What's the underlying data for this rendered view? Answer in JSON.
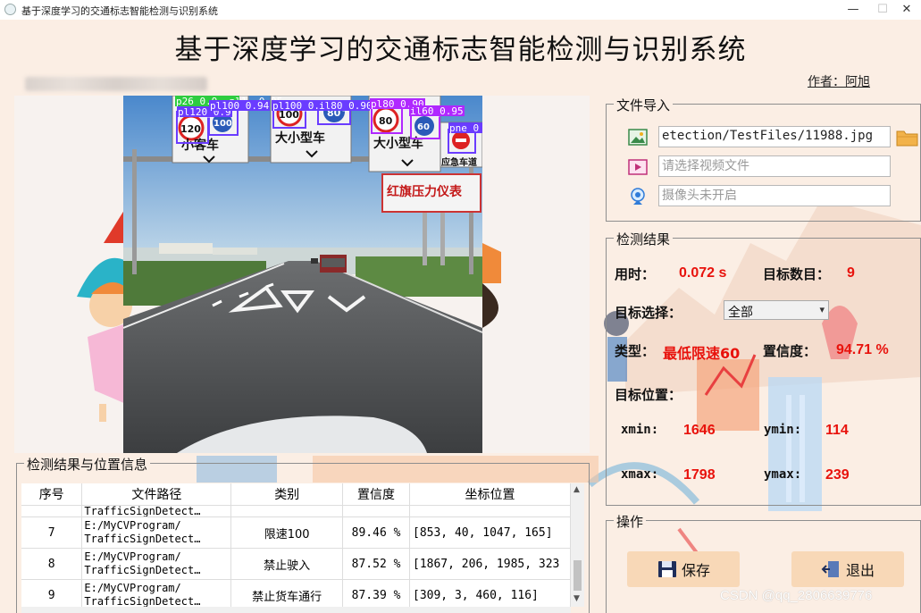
{
  "window": {
    "title": "基于深度学习的交通标志智能检测与识别系统",
    "controls": [
      "—",
      "☐",
      "✕"
    ]
  },
  "header": {
    "main_title": "基于深度学习的交通标志智能检测与识别系统",
    "author": "作者：阿旭"
  },
  "photo": {
    "overhead_signs": [
      "小客车",
      "大小型车",
      "大小型车",
      "应急车道"
    ],
    "speed_numbers": [
      "120",
      "100",
      "100",
      "80",
      "80",
      "60"
    ],
    "billboard_text": "红旗压力仪表",
    "detection_labels": [
      {
        "text": "p26_0.9..pl1..0.95",
        "color": "#2ecc40"
      },
      {
        "text": "pl120_0.9",
        "color": "#6a3cff"
      },
      {
        "text": "pl100_0.94",
        "color": "#6a3cff"
      },
      {
        "text": "pl100_0.9",
        "color": "#6a3cff"
      },
      {
        "text": "il80_0.90",
        "color": "#6a3cff"
      },
      {
        "text": "pl80_0.90",
        "color": "#b028ff"
      },
      {
        "text": "il60_0.95",
        "color": "#b028ff"
      },
      {
        "text": "pne_0",
        "color": "#6a3cff"
      }
    ]
  },
  "file_import": {
    "title": "文件导入",
    "image_path": "etection/TestFiles/11988.jpg",
    "video_placeholder": "请选择视频文件",
    "camera_placeholder": "摄像头未开启"
  },
  "results": {
    "title": "检测结果",
    "time_label": "用时：",
    "time_value": "0.072 s",
    "count_label": "目标数目：",
    "count_value": "9",
    "select_label": "目标选择：",
    "select_value": "全部",
    "type_label": "类型：",
    "type_value": "最低限速60",
    "conf_label": "置信度：",
    "conf_value": "94.71 %",
    "pos_label": "目标位置：",
    "xmin_label": "xmin:",
    "xmin_value": "1646",
    "ymin_label": "ymin:",
    "ymin_value": "114",
    "xmax_label": "xmax:",
    "xmax_value": "1798",
    "ymax_label": "ymax:",
    "ymax_value": "239"
  },
  "operations": {
    "title": "操作",
    "save_label": "保存",
    "exit_label": "退出"
  },
  "table": {
    "title": "检测结果与位置信息",
    "headers": [
      "序号",
      "文件路径",
      "类别",
      "置信度",
      "坐标位置"
    ],
    "partial_row": {
      "path": "TrafficSignDetect…"
    },
    "rows": [
      {
        "idx": "7",
        "path1": "E:/MyCVProgram/",
        "path2": "TrafficSignDetect…",
        "cls": "限速100",
        "conf": "89.46 %",
        "coord": "[853, 40, 1047, 165]"
      },
      {
        "idx": "8",
        "path1": "E:/MyCVProgram/",
        "path2": "TrafficSignDetect…",
        "cls": "禁止驶入",
        "conf": "87.52 %",
        "coord": "[1867, 206, 1985, 323"
      },
      {
        "idx": "9",
        "path1": "E:/MyCVProgram/",
        "path2": "TrafficSignDetect…",
        "cls": "禁止货车通行",
        "conf": "87.39 %",
        "coord": "[309, 3, 460, 116]"
      }
    ]
  },
  "watermark": "CSDN @qq_2806639776",
  "colors": {
    "accent_red": "#e8120c",
    "button_bg": "#f8d8b7",
    "page_bg": "#fbeee4"
  }
}
